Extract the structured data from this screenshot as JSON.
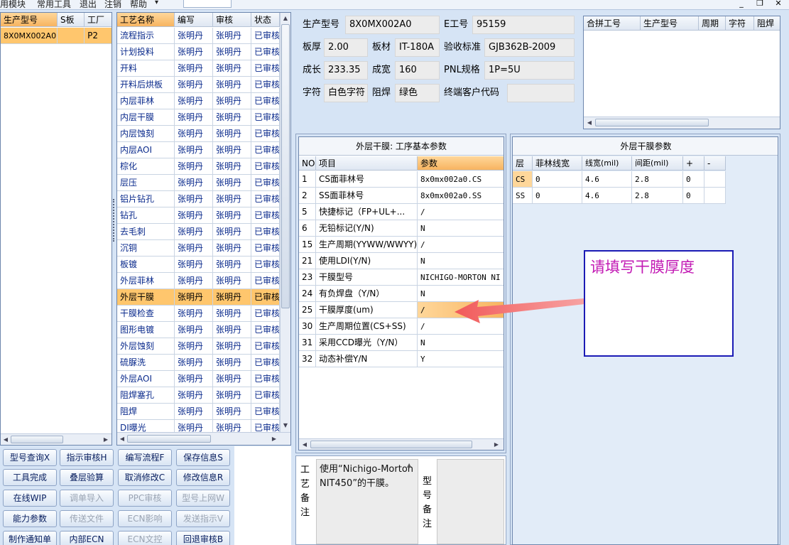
{
  "menu": {
    "items": [
      "用模块",
      "常用工具",
      "退出",
      "注销",
      "帮助"
    ],
    "dropdown_arrow": "▾"
  },
  "window_buttons": {
    "minimize": "_",
    "restore": "❐",
    "close": "✕"
  },
  "model_list": {
    "headers": [
      "生产型号",
      "S板",
      "工厂"
    ],
    "rows": [
      {
        "model": "8X0MX002A0",
        "sboard": "",
        "factory": "P2"
      }
    ]
  },
  "process_list": {
    "headers": [
      "工艺名称",
      "编写",
      "审核",
      "状态"
    ],
    "rows": [
      {
        "name": "流程指示",
        "writer": "张明丹",
        "reviewer": "张明丹",
        "status": "已审核"
      },
      {
        "name": "计划投料",
        "writer": "张明丹",
        "reviewer": "张明丹",
        "status": "已审核"
      },
      {
        "name": "开料",
        "writer": "张明丹",
        "reviewer": "张明丹",
        "status": "已审核"
      },
      {
        "name": "开料后烘板",
        "writer": "张明丹",
        "reviewer": "张明丹",
        "status": "已审核"
      },
      {
        "name": "内层菲林",
        "writer": "张明丹",
        "reviewer": "张明丹",
        "status": "已审核"
      },
      {
        "name": "内层干膜",
        "writer": "张明丹",
        "reviewer": "张明丹",
        "status": "已审核"
      },
      {
        "name": "内层蚀刻",
        "writer": "张明丹",
        "reviewer": "张明丹",
        "status": "已审核"
      },
      {
        "name": "内层AOI",
        "writer": "张明丹",
        "reviewer": "张明丹",
        "status": "已审核"
      },
      {
        "name": "棕化",
        "writer": "张明丹",
        "reviewer": "张明丹",
        "status": "已审核"
      },
      {
        "name": "层压",
        "writer": "张明丹",
        "reviewer": "张明丹",
        "status": "已审核"
      },
      {
        "name": "铝片钻孔",
        "writer": "张明丹",
        "reviewer": "张明丹",
        "status": "已审核"
      },
      {
        "name": "钻孔",
        "writer": "张明丹",
        "reviewer": "张明丹",
        "status": "已审核"
      },
      {
        "name": "去毛刺",
        "writer": "张明丹",
        "reviewer": "张明丹",
        "status": "已审核"
      },
      {
        "name": "沉铜",
        "writer": "张明丹",
        "reviewer": "张明丹",
        "status": "已审核"
      },
      {
        "name": "板镀",
        "writer": "张明丹",
        "reviewer": "张明丹",
        "status": "已审核"
      },
      {
        "name": "外层菲林",
        "writer": "张明丹",
        "reviewer": "张明丹",
        "status": "已审核"
      },
      {
        "name": "外层干膜",
        "writer": "张明丹",
        "reviewer": "张明丹",
        "status": "已审核"
      },
      {
        "name": "干膜检查",
        "writer": "张明丹",
        "reviewer": "张明丹",
        "status": "已审核"
      },
      {
        "name": "图形电镀",
        "writer": "张明丹",
        "reviewer": "张明丹",
        "status": "已审核"
      },
      {
        "name": "外层蚀刻",
        "writer": "张明丹",
        "reviewer": "张明丹",
        "status": "已审核"
      },
      {
        "name": "硫脲洗",
        "writer": "张明丹",
        "reviewer": "张明丹",
        "status": "已审核"
      },
      {
        "name": "外层AOI",
        "writer": "张明丹",
        "reviewer": "张明丹",
        "status": "已审核"
      },
      {
        "name": "阻焊塞孔",
        "writer": "张明丹",
        "reviewer": "张明丹",
        "status": "已审核"
      },
      {
        "name": "阻焊",
        "writer": "张明丹",
        "reviewer": "张明丹",
        "status": "已审核"
      },
      {
        "name": "DI曝光",
        "writer": "张明丹",
        "reviewer": "张明丹",
        "status": "已审核"
      }
    ],
    "selected_index": 16
  },
  "buttons": {
    "model_query": "型号查询X",
    "indicate_review": "指示审核H",
    "write_flow": "编写流程F",
    "save_info": "保存信息S",
    "tool_complete": "工具完成",
    "stack_review": "叠层验算",
    "cancel_modify": "取消修改C",
    "modify_info": "修改信息R",
    "online_wip": "在线WIP",
    "order_import": "调单导入",
    "ppc_review": "PPC审核",
    "model_online": "型号上网W",
    "capability": "能力参数",
    "send_file": "传送文件",
    "ecn_impact": "ECN影响",
    "send_indicate": "发送指示V",
    "make_notice": "制作通知单",
    "internal_ecn": "内部ECN",
    "ecn_control": "ECN文控",
    "return_review": "回退审核B"
  },
  "info": {
    "model_label": "生产型号",
    "model_value": "8X0MX002A0",
    "e_no_label": "E工号",
    "e_no_value": "95159",
    "thickness_label": "板厚",
    "thickness_value": "2.00",
    "material_label": "板材",
    "material_value": "IT-180A",
    "standard_label": "验收标准",
    "standard_value": "GJB362B-2009",
    "length_label": "成长",
    "length_value": "233.35",
    "width_label": "成宽",
    "width_value": "160",
    "pnl_label": "PNL规格",
    "pnl_value": "1P=5U",
    "char_label": "字符",
    "char_value": "白色字符",
    "mask_label": "阻焊",
    "mask_value": "绿色",
    "customer_label": "终端客户代码",
    "customer_value": ""
  },
  "merge_table": {
    "headers": [
      "合拼工号",
      "生产型号",
      "周期",
      "字符",
      "阻焊"
    ]
  },
  "params": {
    "title": "外层干膜: 工序基本参数",
    "headers": [
      "NO",
      "项目",
      "参数"
    ],
    "rows": [
      {
        "no": "1",
        "item": "CS面菲林号",
        "value": "8x0mx002a0.CS"
      },
      {
        "no": "2",
        "item": "SS面菲林号",
        "value": "8x0mx002a0.SS"
      },
      {
        "no": "5",
        "item": "快捷标记（FP+UL+...",
        "value": "/"
      },
      {
        "no": "6",
        "item": "无铅标记(Y/N)",
        "value": "N"
      },
      {
        "no": "15",
        "item": "生产周期(YYWW/WWYY)",
        "value": "/"
      },
      {
        "no": "21",
        "item": "使用LDI(Y/N)",
        "value": "N"
      },
      {
        "no": "23",
        "item": "干膜型号",
        "value": "NICHIGO-MORTON NI"
      },
      {
        "no": "24",
        "item": "有负焊盘（Y/N）",
        "value": "N"
      },
      {
        "no": "25",
        "item": "干膜厚度(um)",
        "value": "/"
      },
      {
        "no": "30",
        "item": "生产周期位置(CS+SS)",
        "value": "/"
      },
      {
        "no": "31",
        "item": "采用CCD曝光（Y/N）",
        "value": "N"
      },
      {
        "no": "32",
        "item": "动态补偿Y/N",
        "value": "Y"
      }
    ],
    "highlight_index": 8
  },
  "film_params": {
    "title": "外层干膜参数",
    "headers": [
      "层",
      "菲林线宽",
      "线宽(mil)",
      "间距(mil)",
      "+",
      "-"
    ],
    "rows": [
      {
        "layer": "CS",
        "film_width": "0",
        "width": "4.6",
        "space": "2.8",
        "plus": "0",
        "minus": ""
      },
      {
        "layer": "SS",
        "film_width": "0",
        "width": "4.6",
        "space": "2.8",
        "plus": "0",
        "minus": ""
      }
    ]
  },
  "annotation": {
    "text": "请填写干膜厚度"
  },
  "remarks": {
    "process_label": "工艺备注",
    "process_text": "使用“Nichigo-Morton NIT450”的干膜。",
    "model_label": "型号备注"
  },
  "colors": {
    "selected_row": "#ffc66d",
    "arrow": "#f26b6b",
    "annotation_text": "#c21ab4",
    "annotation_border": "#1b1bb5"
  }
}
